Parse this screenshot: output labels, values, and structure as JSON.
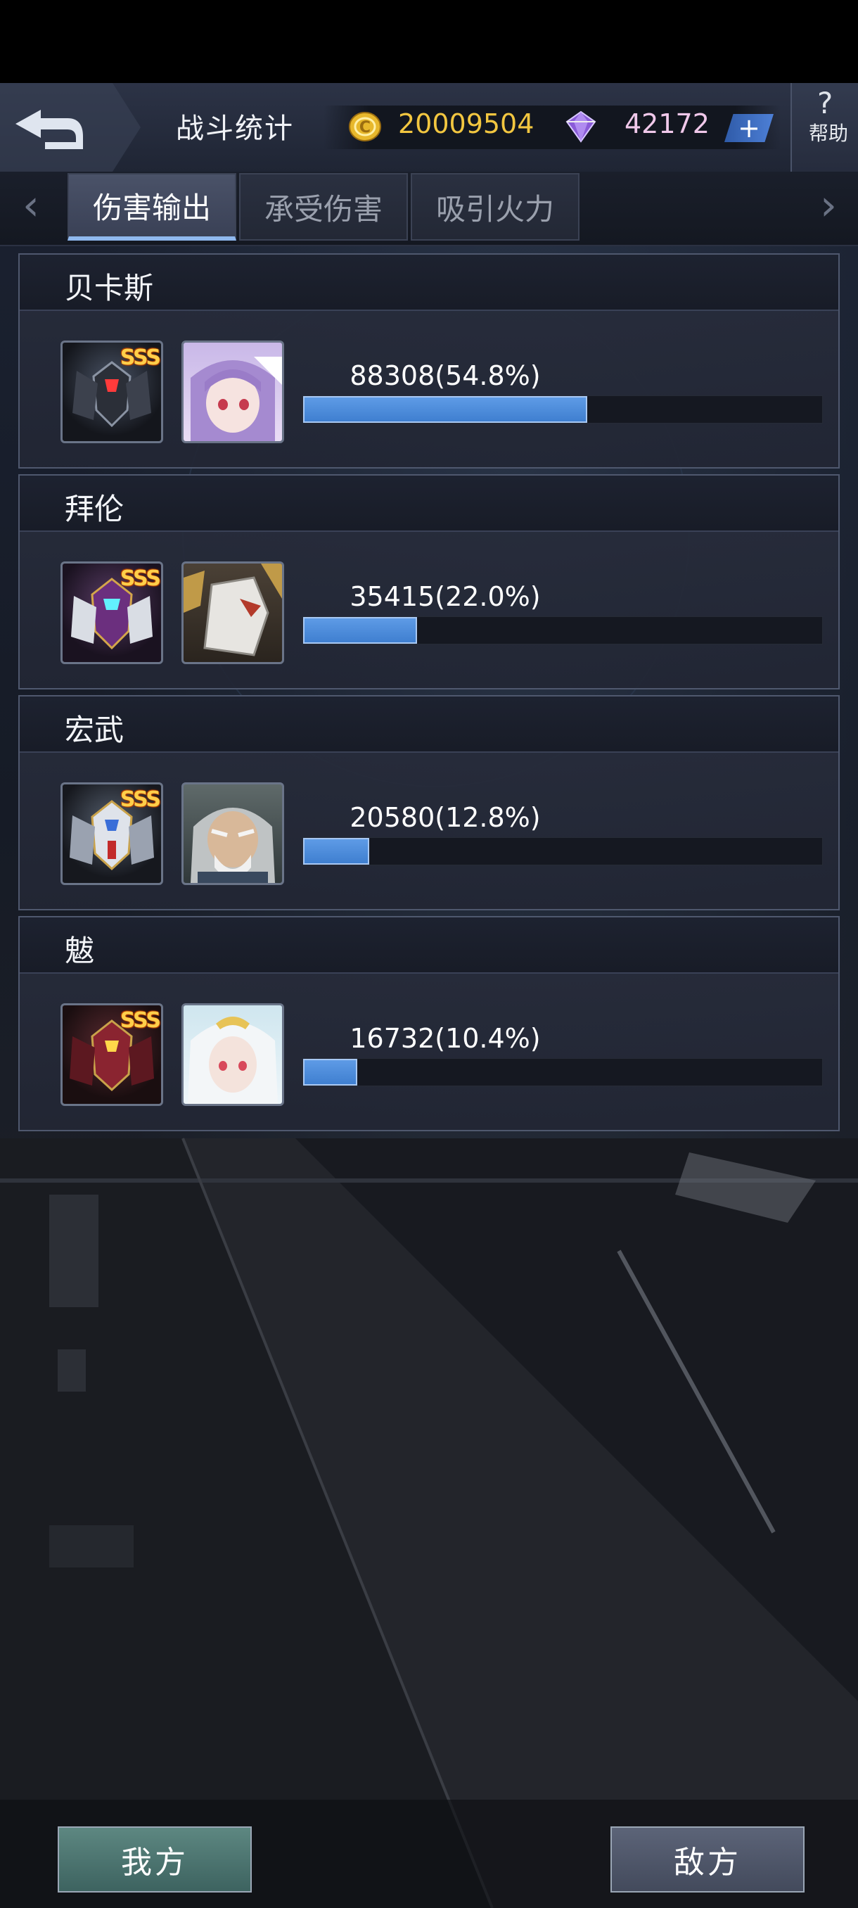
{
  "header": {
    "title": "战斗统计",
    "gold": "20009504",
    "gems": "42172",
    "plus_label": "+",
    "help_glyph": "?",
    "help_label": "帮助"
  },
  "tabs": [
    {
      "label": "伤害输出",
      "active": true
    },
    {
      "label": "承受伤害",
      "active": false
    },
    {
      "label": "吸引火力",
      "active": false
    }
  ],
  "nav": {
    "prev": "‹",
    "next": "›"
  },
  "heroes": [
    {
      "name": "贝卡斯",
      "rank": "SSS",
      "damage": "88308(54.8%)",
      "share": 0.548
    },
    {
      "name": "拜伦",
      "rank": "SSS",
      "damage": "35415(22.0%)",
      "share": 0.22
    },
    {
      "name": "宏武",
      "rank": "SSS",
      "damage": "20580(12.8%)",
      "share": 0.128
    },
    {
      "name": "魃",
      "rank": "SSS",
      "damage": "16732(10.4%)",
      "share": 0.104
    }
  ],
  "buttons": {
    "ally": "我方",
    "enemy": "敌方"
  },
  "colors": {
    "gold": "#f2c640",
    "gem": "#f0c8ea",
    "bar": "#4f8ddc",
    "ally_button": "#4f7571",
    "enemy_button": "#4f566a"
  }
}
